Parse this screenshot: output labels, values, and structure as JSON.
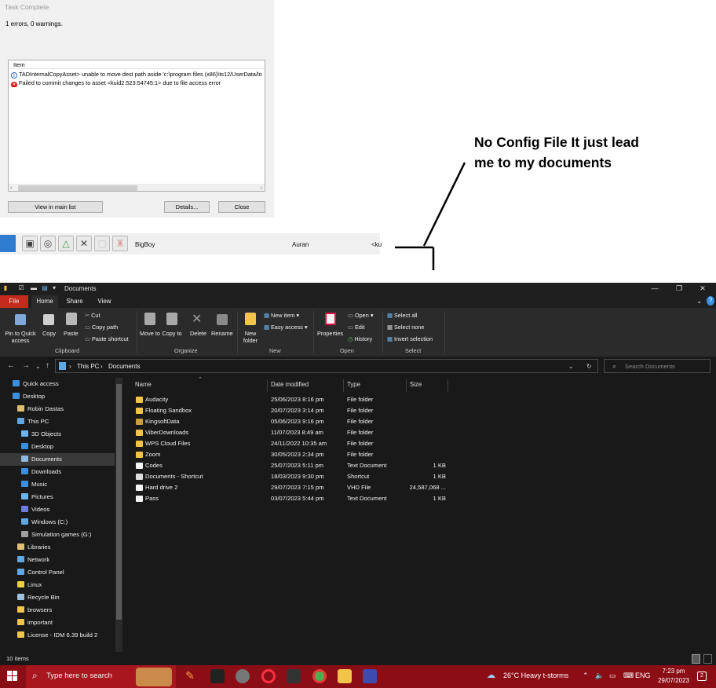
{
  "dialog": {
    "title": "Task Complete",
    "summary": "1 errors, 0 warnings.",
    "column": "Item",
    "rows": [
      {
        "type": "info",
        "text": "TADInternalCopyAsset> unable to move dest path aside 'c:\\program files (x86)\\ts12/UserData/lo"
      },
      {
        "type": "error",
        "text": "Failed to commit changes to asset <kuid2:523:54745:1> due to file access error"
      }
    ],
    "buttons": {
      "view": "View in main list",
      "details": "Details...",
      "close": "Close"
    }
  },
  "gamebar": {
    "name": "BigBoy",
    "author": "Auran",
    "kuid": "<ku"
  },
  "annotation": "No Config File It just lead me to my documents",
  "explorer": {
    "title": "Documents",
    "tabs": [
      "File",
      "Home",
      "Share",
      "View"
    ],
    "ribbon": {
      "clipboard": {
        "pin": "Pin to Quick access",
        "copy": "Copy",
        "paste": "Paste",
        "cut": "Cut",
        "copy_path": "Copy path",
        "paste_shortcut": "Paste shortcut",
        "group": "Clipboard"
      },
      "organize": {
        "move": "Move to",
        "copy": "Copy to",
        "delete": "Delete",
        "rename": "Rename",
        "group": "Organize"
      },
      "new": {
        "folder": "New folder",
        "item": "New item",
        "easy": "Easy access",
        "group": "New"
      },
      "open": {
        "properties": "Properties",
        "open": "Open",
        "edit": "Edit",
        "history": "History",
        "group": "Open"
      },
      "select": {
        "all": "Select all",
        "none": "Select none",
        "invert": "Invert selection",
        "group": "Select"
      }
    },
    "address": {
      "crumbs": [
        "This PC",
        "Documents"
      ],
      "search_placeholder": "Search Documents"
    },
    "nav": [
      {
        "label": "Quick access",
        "icon": "star-icon",
        "color": "#3b8fe0",
        "indent": 0
      },
      {
        "label": "Desktop",
        "icon": "desktop-icon",
        "color": "#3b8fe0",
        "indent": 0
      },
      {
        "label": "Robin Dastas",
        "icon": "user-folder-icon",
        "color": "#e0c070",
        "indent": 1
      },
      {
        "label": "This PC",
        "icon": "computer-icon",
        "color": "#5fa8e8",
        "indent": 1
      },
      {
        "label": "3D Objects",
        "icon": "cube-icon",
        "color": "#6bb6f2",
        "indent": 2
      },
      {
        "label": "Desktop",
        "icon": "desktop-icon",
        "color": "#3b8fe0",
        "indent": 2
      },
      {
        "label": "Documents",
        "icon": "documents-icon",
        "color": "#8fb8e0",
        "indent": 2,
        "selected": true
      },
      {
        "label": "Downloads",
        "icon": "download-icon",
        "color": "#3b8fe0",
        "indent": 2
      },
      {
        "label": "Music",
        "icon": "music-icon",
        "color": "#3b8fe0",
        "indent": 2
      },
      {
        "label": "Pictures",
        "icon": "pictures-icon",
        "color": "#6bb6f2",
        "indent": 2
      },
      {
        "label": "Videos",
        "icon": "videos-icon",
        "color": "#6b7be0",
        "indent": 2
      },
      {
        "label": "Windows (C:)",
        "icon": "drive-icon",
        "color": "#5fa8e8",
        "indent": 2
      },
      {
        "label": "Simulation games (G:)",
        "icon": "drive-icon",
        "color": "#a0a0a0",
        "indent": 2
      },
      {
        "label": "Libraries",
        "icon": "libraries-icon",
        "color": "#e0c070",
        "indent": 1
      },
      {
        "label": "Network",
        "icon": "network-icon",
        "color": "#5fa8e8",
        "indent": 1
      },
      {
        "label": "Control Panel",
        "icon": "control-panel-icon",
        "color": "#5fa8e8",
        "indent": 1
      },
      {
        "label": "Linux",
        "icon": "linux-icon",
        "color": "#f0d040",
        "indent": 1
      },
      {
        "label": "Recycle Bin",
        "icon": "recycle-bin-icon",
        "color": "#a0c0e0",
        "indent": 1
      },
      {
        "label": "browsers",
        "icon": "folder-icon",
        "color": "#f2c54a",
        "indent": 1
      },
      {
        "label": "important",
        "icon": "folder-icon",
        "color": "#f2c54a",
        "indent": 1
      },
      {
        "label": "License - IDM 6.39 build 2",
        "icon": "folder-icon",
        "color": "#f2c54a",
        "indent": 1
      }
    ],
    "columns": {
      "name": "Name",
      "date": "Date modified",
      "type": "Type",
      "size": "Size"
    },
    "files": [
      {
        "name": "Audacity",
        "date": "25/06/2023 8:16 pm",
        "type": "File folder",
        "size": "",
        "kind": "folder"
      },
      {
        "name": "Floating Sandbox",
        "date": "20/07/2023 3:14 pm",
        "type": "File folder",
        "size": "",
        "kind": "folder"
      },
      {
        "name": "KingsoftData",
        "date": "05/06/2023 9:16 pm",
        "type": "File folder",
        "size": "",
        "kind": "folder-dark"
      },
      {
        "name": "ViberDownloads",
        "date": "11/07/2023 8:49 am",
        "type": "File folder",
        "size": "",
        "kind": "folder"
      },
      {
        "name": "WPS Cloud Files",
        "date": "24/11/2022 10:35 am",
        "type": "File folder",
        "size": "",
        "kind": "folder"
      },
      {
        "name": "Zoom",
        "date": "30/05/2023 2:34 pm",
        "type": "File folder",
        "size": "",
        "kind": "folder"
      },
      {
        "name": "Codes",
        "date": "25/07/2023 5:11 pm",
        "type": "Text Document",
        "size": "1 KB",
        "kind": "doc"
      },
      {
        "name": "Documents - Shortcut",
        "date": "18/03/2023 9:30 pm",
        "type": "Shortcut",
        "size": "1 KB",
        "kind": "shortcut"
      },
      {
        "name": "Hard drive 2",
        "date": "29/07/2023 7:15 pm",
        "type": "VHD File",
        "size": "24,587,068 ...",
        "kind": "doc"
      },
      {
        "name": "Pass",
        "date": "03/07/2023 5:44 pm",
        "type": "Text Document",
        "size": "1 KB",
        "kind": "doc"
      }
    ],
    "status": "10 items"
  },
  "taskbar": {
    "search_placeholder": "Type here to search",
    "weather": "26°C  Heavy t-storms",
    "lang": "ENG",
    "time": "7:23 pm",
    "date": "29/07/2023",
    "notifications": "2"
  }
}
